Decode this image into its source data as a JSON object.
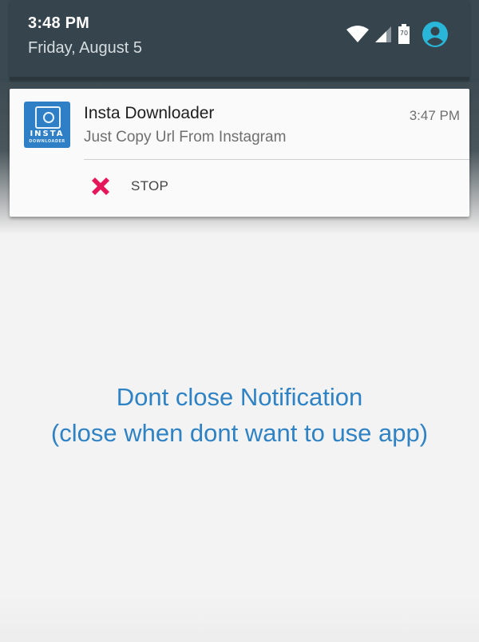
{
  "status_bar": {
    "time": "3:48 PM",
    "date": "Friday, August 5",
    "battery_level": "70",
    "icons": [
      "wifi-icon",
      "cell-signal-icon",
      "battery-icon",
      "account-icon"
    ],
    "account_color": "#29b6d8"
  },
  "notification": {
    "app_name": "Insta Downloader",
    "text": "Just Copy Url From Instagram",
    "time": "3:47 PM",
    "icon_word_top": "INSTA",
    "icon_word_bottom": "DOWNLOADER",
    "icon_color": "#2f7fc6",
    "action": {
      "label": "STOP",
      "icon": "close-x-icon",
      "icon_color": "#e5175a"
    }
  },
  "message": {
    "line1": "Dont close Notification",
    "line2": "(close when dont want to use app)",
    "color": "#2f83c4"
  }
}
